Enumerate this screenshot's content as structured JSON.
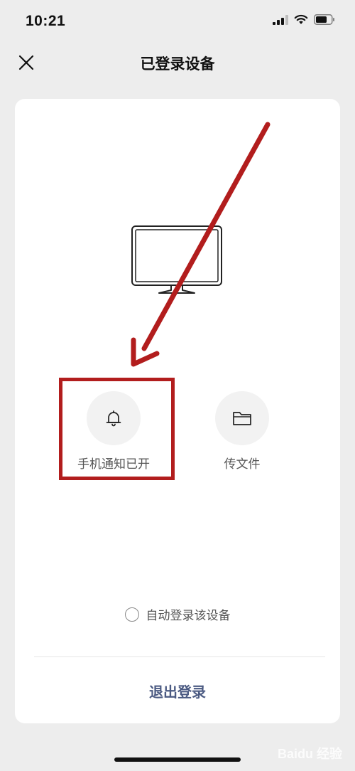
{
  "status_bar": {
    "time": "10:21",
    "icons": [
      "cellular-signal-icon",
      "wifi-icon",
      "battery-icon"
    ]
  },
  "nav": {
    "title": "已登录设备",
    "close_icon": "close-icon"
  },
  "device": {
    "icon": "desktop-monitor-icon"
  },
  "actions": [
    {
      "label": "手机通知已开",
      "icon": "bell-icon"
    },
    {
      "label": "传文件",
      "icon": "folder-icon"
    }
  ],
  "auto_login": {
    "label": "自动登录该设备",
    "checked": false
  },
  "logout": {
    "label": "退出登录"
  },
  "annotation": {
    "color": "#b21d1d"
  },
  "colors": {
    "background": "#ededed",
    "card": "#ffffff",
    "logout_text": "#4b5a82"
  },
  "watermark": {
    "text": "Baidu 经验"
  }
}
